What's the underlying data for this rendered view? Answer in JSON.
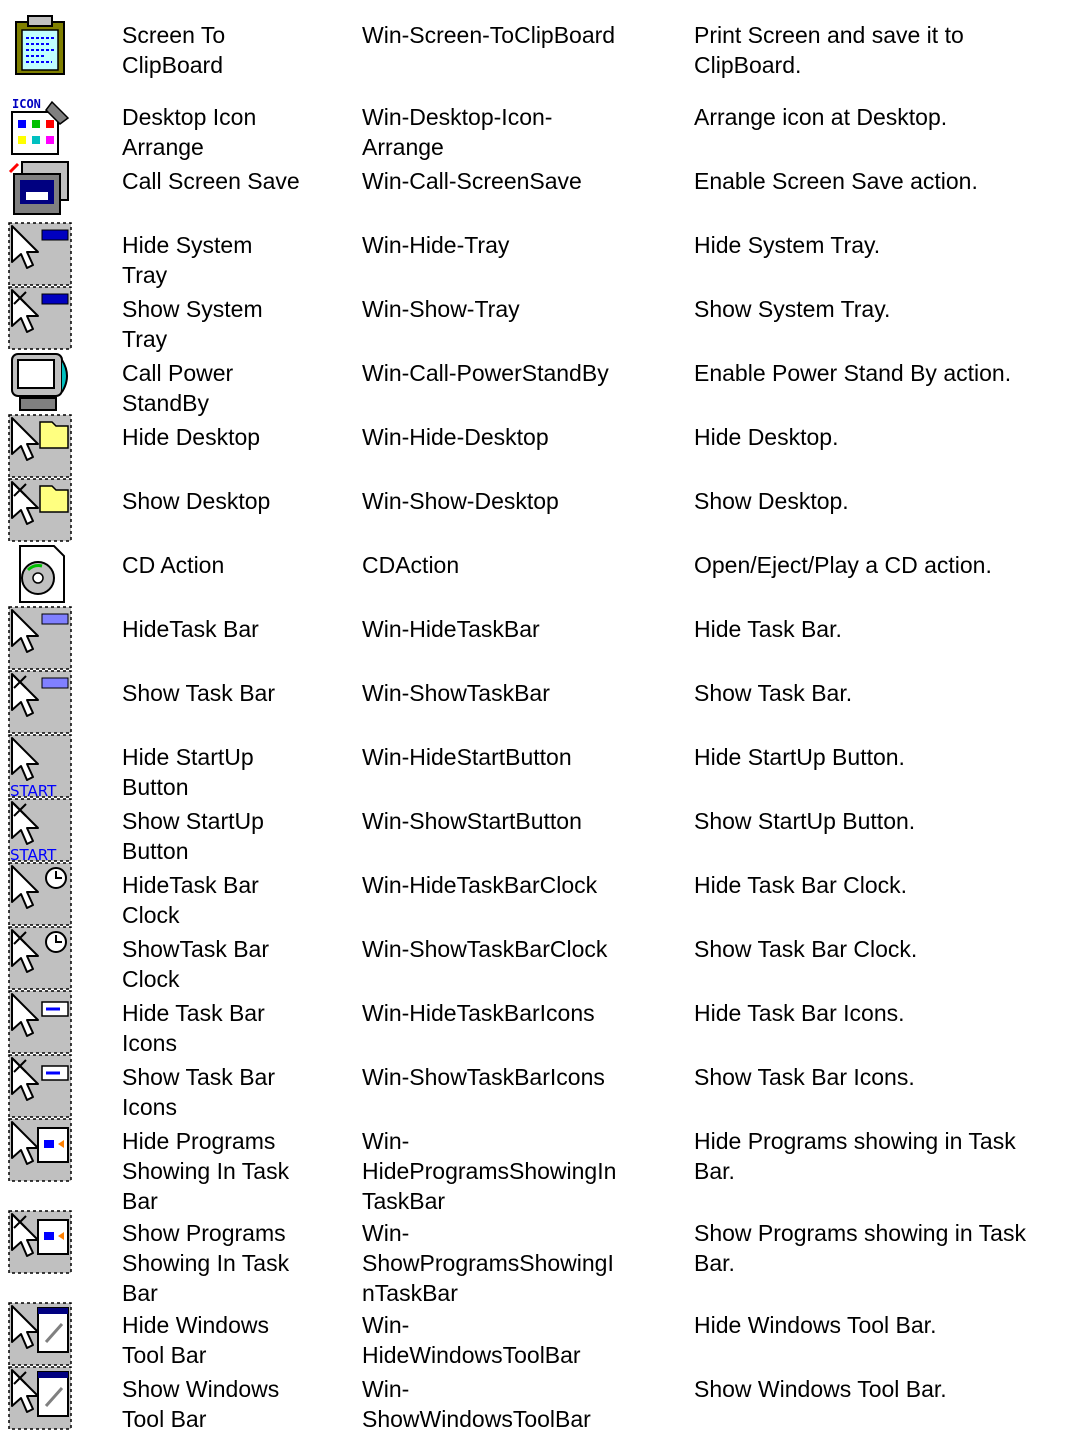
{
  "rows": [
    {
      "icon": "clipboard-icon",
      "name": "Screen To\nClipBoard",
      "command": "Win-Screen-ToClipBoard",
      "description": "Print Screen and save it to\nClipBoard."
    },
    {
      "icon": "desktop-icon-arrange-icon",
      "icon_text": "ICON",
      "name": "Desktop Icon\nArrange",
      "command": "Win-Desktop-Icon-\nArrange",
      "description": "Arrange icon at Desktop."
    },
    {
      "icon": "screen-save-icon",
      "name": "Call Screen Save",
      "command": "Win-Call-ScreenSave",
      "description": "Enable Screen Save action."
    },
    {
      "icon": "hide-system-tray-icon",
      "name": "Hide System\nTray",
      "command": "Win-Hide-Tray",
      "description": "Hide System Tray."
    },
    {
      "icon": "show-system-tray-icon",
      "name": "Show System\nTray",
      "command": "Win-Show-Tray",
      "description": "Show System Tray."
    },
    {
      "icon": "monitor-icon",
      "name": "Call Power\nStandBy",
      "command": "Win-Call-PowerStandBy",
      "description": "Enable Power Stand By action."
    },
    {
      "icon": "hide-desktop-icon",
      "name": "Hide Desktop",
      "command": "Win-Hide-Desktop",
      "description": "Hide Desktop."
    },
    {
      "icon": "show-desktop-icon",
      "name": "Show Desktop",
      "command": "Win-Show-Desktop",
      "description": "Show Desktop."
    },
    {
      "icon": "cd-icon",
      "name": "CD Action",
      "command": "CDAction",
      "description": "Open/Eject/Play a CD action."
    },
    {
      "icon": "hide-task-bar-icon",
      "name": "HideTask Bar",
      "command": "Win-HideTaskBar",
      "description": "Hide Task Bar."
    },
    {
      "icon": "show-task-bar-icon",
      "name": "Show Task Bar",
      "command": "Win-ShowTaskBar",
      "description": "Show Task Bar."
    },
    {
      "icon": "hide-start-button-icon",
      "icon_text": "START",
      "name": "Hide StartUp\nButton",
      "command": "Win-HideStartButton",
      "description": "Hide StartUp Button."
    },
    {
      "icon": "show-start-button-icon",
      "icon_text": "START",
      "name": "Show StartUp\nButton",
      "command": "Win-ShowStartButton",
      "description": "Show StartUp Button."
    },
    {
      "icon": "hide-clock-icon",
      "name": "HideTask Bar\nClock",
      "command": "Win-HideTaskBarClock",
      "description": "Hide Task Bar Clock."
    },
    {
      "icon": "show-clock-icon",
      "name": "ShowTask Bar\nClock",
      "command": "Win-ShowTaskBarClock",
      "description": "Show Task Bar Clock."
    },
    {
      "icon": "hide-task-bar-icons-icon",
      "name": "Hide Task Bar\nIcons",
      "command": "Win-HideTaskBarIcons",
      "description": "Hide Task Bar Icons."
    },
    {
      "icon": "show-task-bar-icons-icon",
      "name": "Show Task Bar\nIcons",
      "command": "Win-ShowTaskBarIcons",
      "description": "Show Task Bar Icons."
    },
    {
      "icon": "hide-programs-icon",
      "name": "Hide Programs\nShowing In Task\nBar",
      "command": "Win-\nHideProgramsShowingIn\nTaskBar",
      "description": "Hide Programs showing in Task\nBar."
    },
    {
      "icon": "show-programs-icon",
      "name": "Show Programs\nShowing In Task\nBar",
      "command": "Win-\nShowProgramsShowingI\nnTaskBar",
      "description": "Show Programs showing in Task\nBar."
    },
    {
      "icon": "hide-toolbar-icon",
      "name": "Hide Windows\nTool Bar",
      "command": "Win-\nHideWindowsToolBar",
      "description": "Hide Windows Tool Bar."
    },
    {
      "icon": "show-toolbar-icon",
      "name": "Show Windows\nTool Bar",
      "command": "Win-\nShowWindowsToolBar",
      "description": "Show Windows Tool Bar."
    }
  ]
}
